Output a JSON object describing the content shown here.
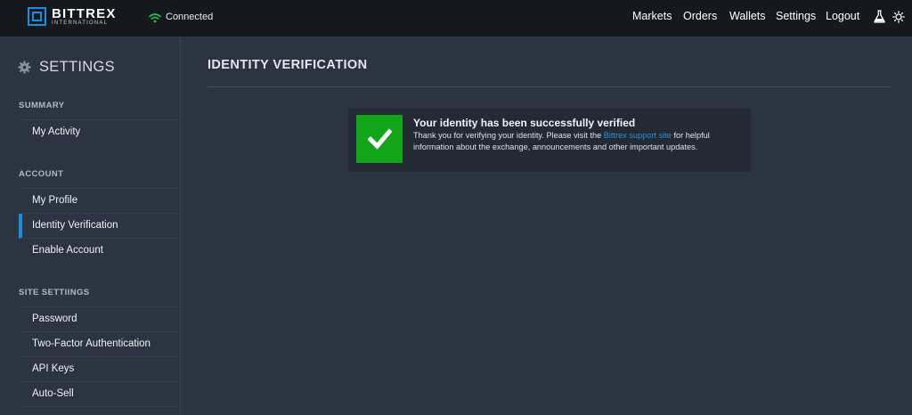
{
  "brand": {
    "name": "BITTREX",
    "sub": "INTERNATIONAL",
    "accent_color": "#1a8fd9"
  },
  "status": {
    "label": "Connected",
    "icon": "wifi-icon",
    "color": "#27c24c"
  },
  "nav": {
    "items": [
      "Markets",
      "Orders",
      "Wallets",
      "Settings",
      "Logout"
    ],
    "icons": [
      "flask-icon",
      "sun-icon"
    ]
  },
  "sidebar": {
    "title": "SETTINGS",
    "title_icon": "gear-icon",
    "sections": [
      {
        "label": "SUMMARY",
        "items": [
          "My Activity"
        ]
      },
      {
        "label": "ACCOUNT",
        "items": [
          "My Profile",
          "Identity Verification",
          "Enable Account"
        ]
      },
      {
        "label": "SITE SETTIINGS",
        "items": [
          "Password",
          "Two-Factor Authentication",
          "API Keys",
          "Auto-Sell"
        ]
      }
    ],
    "active_item": "Identity Verification"
  },
  "main": {
    "title": "IDENTITY VERIFICATION",
    "notice": {
      "icon": "checkmark-icon",
      "color": "#12a51a",
      "title": "Your identity has been successfully verified",
      "text_before": "Thank you for verifying your identity. Please visit the ",
      "link": "Bittrex support site",
      "text_after": " for helpful information about the exchange, announcements and other important updates."
    }
  }
}
